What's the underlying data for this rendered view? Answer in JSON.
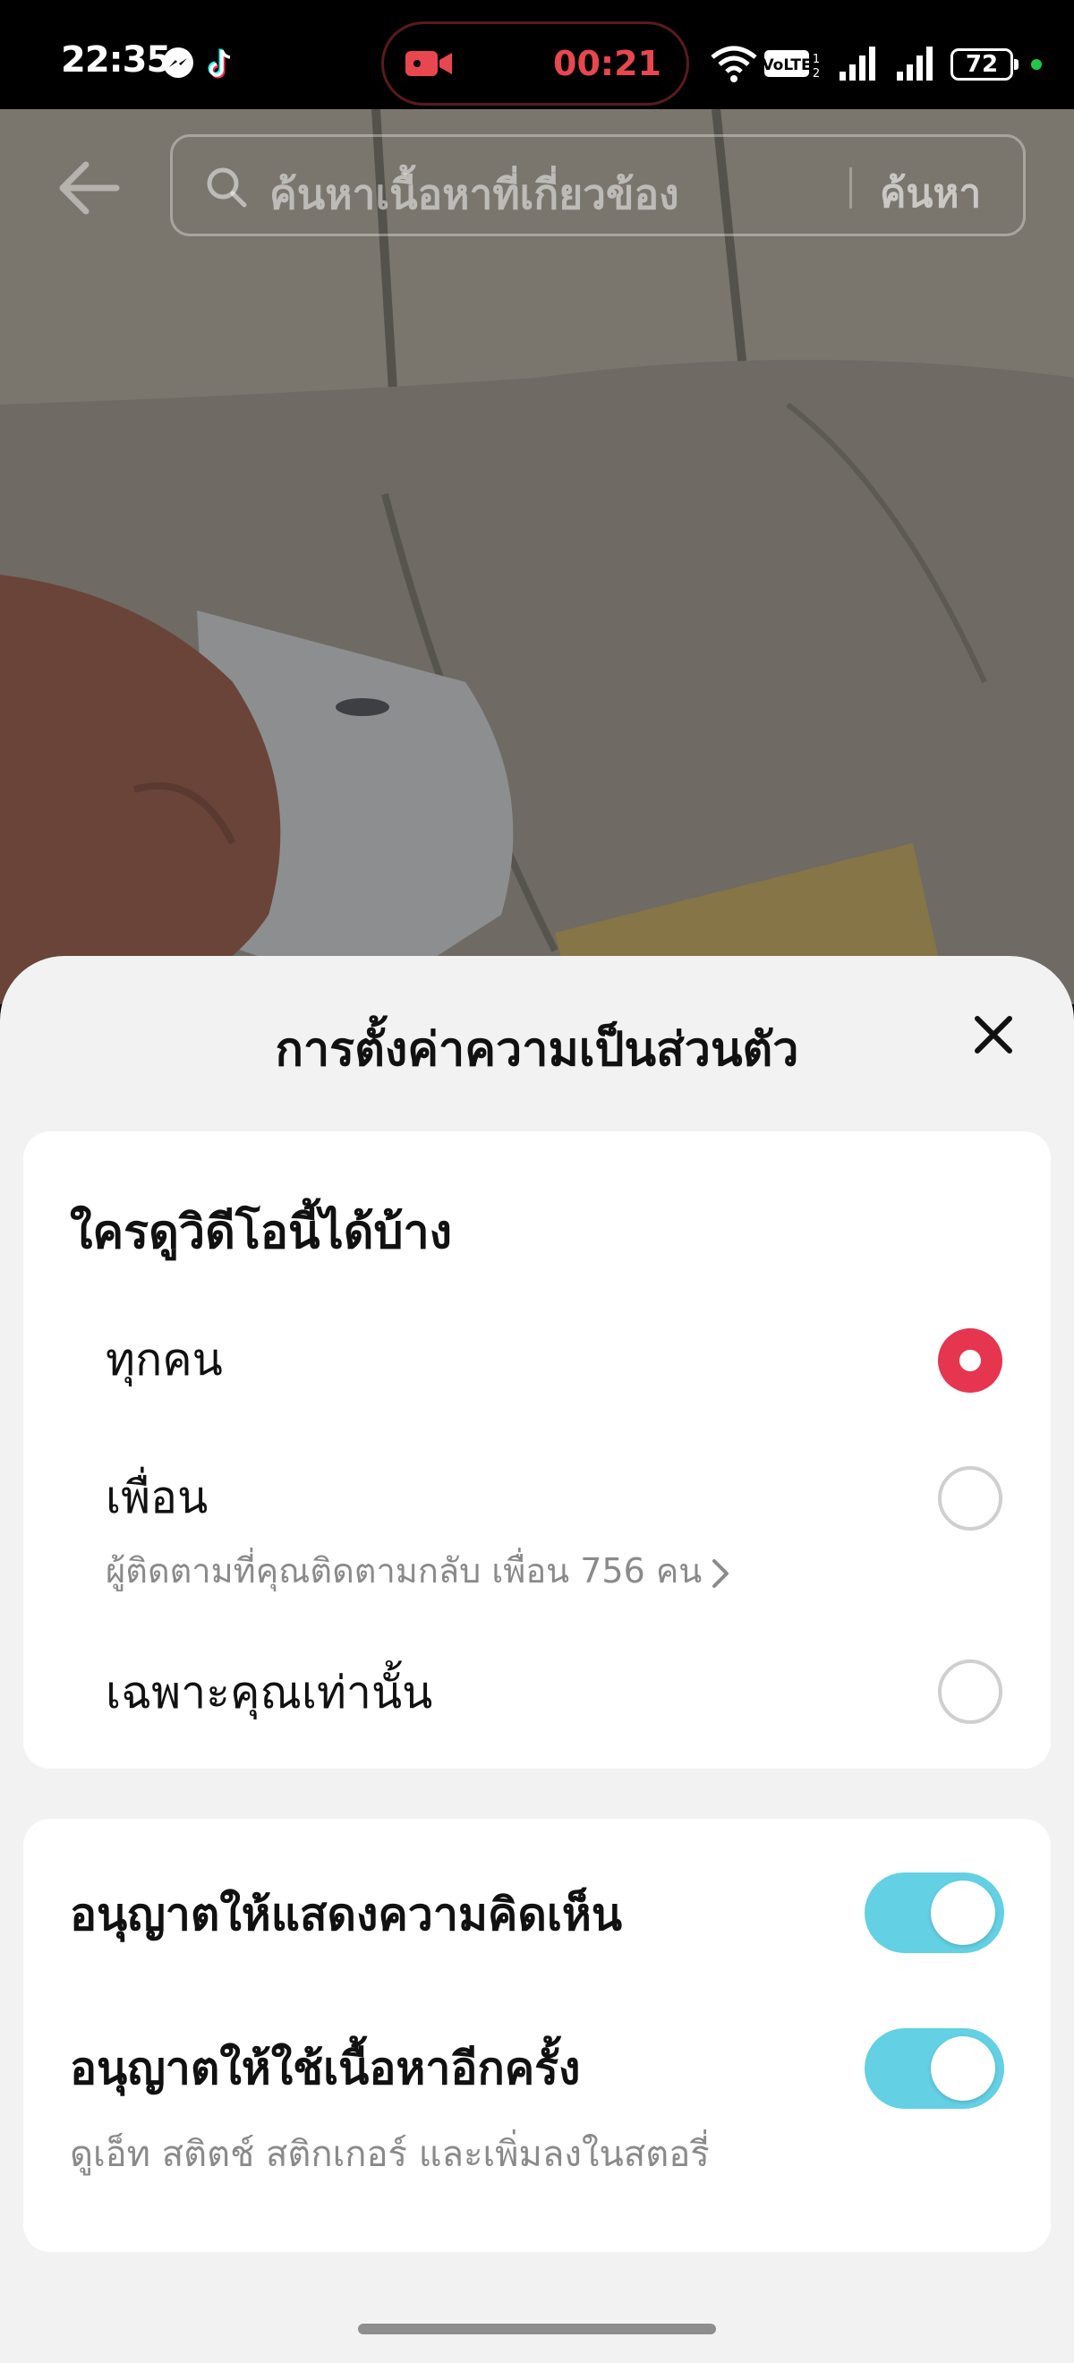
{
  "status_bar": {
    "time": "22:35",
    "app_icons": [
      "messenger-icon",
      "tiktok-icon"
    ],
    "recording_timer": "00:21",
    "network_label": "VoLTE",
    "battery_level": "72",
    "colors": {
      "recording": "#e8474f",
      "battery_dot": "#1ec94a"
    }
  },
  "search": {
    "placeholder": "ค้นหาเนื้อหาที่เกี่ยวข้อง",
    "button_label": "ค้นหา"
  },
  "sheet": {
    "title": "การตั้งค่าความเป็นส่วนตัว",
    "visibility": {
      "heading": "ใครดูวิดีโอนี้ได้บ้าง",
      "options": [
        {
          "label": "ทุกคน",
          "selected": true
        },
        {
          "label": "เพื่อน",
          "selected": false,
          "sublabel": "ผู้ติดตามที่คุณติดตามกลับ เพื่อน 756 คน"
        },
        {
          "label": "เฉพาะคุณเท่านั้น",
          "selected": false
        }
      ]
    },
    "permissions": [
      {
        "label": "อนุญาตให้แสดงความคิดเห็น",
        "enabled": true
      },
      {
        "label": "อนุญาตให้ใช้เนื้อหาอีกครั้ง",
        "enabled": true,
        "sublabel": "ดูเอ็ท สติตช์ สติกเกอร์ และเพิ่มลงในสตอรี่"
      }
    ],
    "colors": {
      "radio_selected": "#e6354f",
      "toggle_on": "#63d0e3"
    }
  }
}
